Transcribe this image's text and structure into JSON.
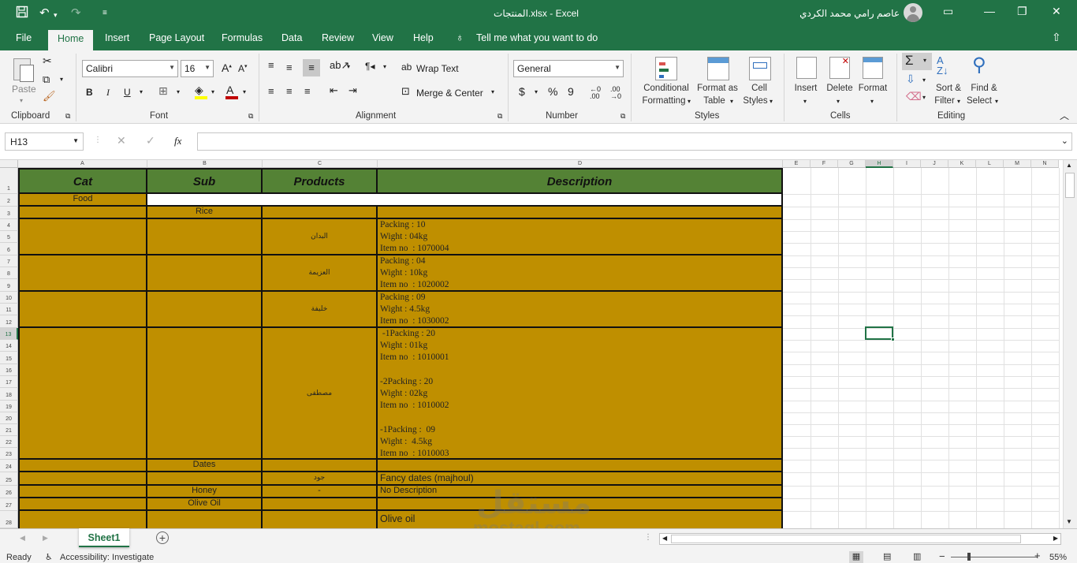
{
  "window": {
    "title": "المنتجات.xlsx  -  Excel",
    "user": "عاصم رامي محمد الكردي"
  },
  "menu": {
    "tabs": [
      "File",
      "Home",
      "Insert",
      "Page Layout",
      "Formulas",
      "Data",
      "Review",
      "View",
      "Help"
    ],
    "tell_me": "Tell me what you want to do"
  },
  "ribbon": {
    "clipboard": {
      "label": "Clipboard",
      "paste": "Paste"
    },
    "font": {
      "label": "Font",
      "name": "Calibri",
      "size": "16",
      "bold": "B",
      "italic": "I",
      "underline": "U"
    },
    "alignment": {
      "label": "Alignment",
      "wrap": "Wrap Text",
      "merge": "Merge & Center"
    },
    "number": {
      "label": "Number",
      "format": "General",
      "currency": "$",
      "percent": "%",
      "comma": "9"
    },
    "styles": {
      "label": "Styles",
      "conditional": "Conditional",
      "conditional2": "Formatting",
      "format_table": "Format as",
      "format_table2": "Table",
      "cell_styles": "Cell",
      "cell_styles2": "Styles"
    },
    "cells": {
      "label": "Cells",
      "insert": "Insert",
      "delete": "Delete",
      "format": "Format"
    },
    "editing": {
      "label": "Editing",
      "sort": "Sort &",
      "sort2": "Filter",
      "find": "Find &",
      "find2": "Select"
    }
  },
  "formula_bar": {
    "name_box": "H13",
    "fx": "fx",
    "value": ""
  },
  "grid": {
    "columns": [
      "A",
      "B",
      "C",
      "D",
      "E",
      "F",
      "G",
      "H",
      "I",
      "J",
      "K",
      "L",
      "M",
      "N"
    ],
    "rows": [
      "1",
      "2",
      "3",
      "4",
      "5",
      "6",
      "7",
      "8",
      "9",
      "10",
      "11",
      "12",
      "13",
      "14",
      "15",
      "16",
      "17",
      "18",
      "19",
      "20",
      "21",
      "22",
      "23",
      "24",
      "25",
      "26",
      "27",
      "28"
    ],
    "header": {
      "cat": "Cat",
      "sub": "Sub",
      "products": "Products",
      "description": "Description"
    },
    "cells": {
      "food": "Food",
      "rice": "Rice",
      "p1": "البدان",
      "d1": "Packing : 10\nWight : 04kg\nItem no  : 1070004",
      "p2": "العزيمة",
      "d2": "Packing : 04\nWight : 10kg\nItem no  : 1020002",
      "p3": "خليفة",
      "d3": "Packing : 09\nWight : 4.5kg\nItem no  : 1030002",
      "p4": "مصطفى",
      "d4": " -1Packing : 20\nWight : 01kg\nItem no  : 1010001\n\n-2Packing : 20\nWight : 02kg\nItem no  : 1010002\n\n-1Packing :  09\nWight :  4.5kg\nItem no  : 1010003",
      "dates": "Dates",
      "p5": "جود",
      "d5": "Fancy dates (majhoul)",
      "honey": "Honey",
      "p6": "-",
      "d6": "No  Description",
      "olive": "Olive Oil",
      "d7": "Olive oil"
    }
  },
  "sheets": {
    "active": "Sheet1"
  },
  "status": {
    "ready": "Ready",
    "accessibility": "Accessibility: Investigate",
    "zoom": "55%"
  },
  "watermark": {
    "ar": "مستقل",
    "en": "mostaql.com"
  }
}
